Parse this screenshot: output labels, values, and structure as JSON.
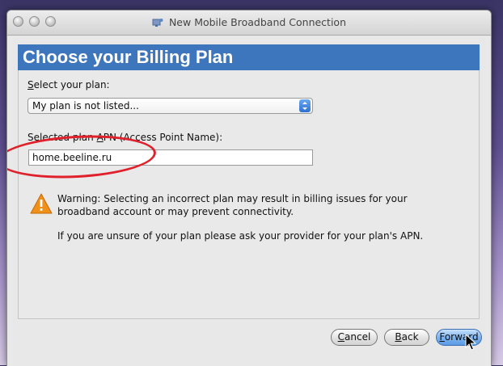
{
  "window": {
    "title": "New Mobile Broadband Connection"
  },
  "header": {
    "title": "Choose your Billing Plan"
  },
  "plan": {
    "label_prefix": "",
    "label_accel": "S",
    "label_rest": "elect your plan:",
    "selected": "My plan is not listed..."
  },
  "apn": {
    "label_pre": "Selected plan ",
    "label_accel": "A",
    "label_post": "PN (Access Point Name):",
    "value": "home.beeline.ru"
  },
  "warning": {
    "text": "Warning: Selecting an incorrect plan may result in billing issues for your broadband account or may prevent connectivity.",
    "unsure": "If you are unsure of your plan please ask your provider for your plan's APN."
  },
  "buttons": {
    "cancel_accel": "C",
    "cancel_rest": "ancel",
    "back_accel": "B",
    "back_rest": "ack",
    "forward_accel": "F",
    "forward_rest": "orward"
  },
  "colors": {
    "header_bg": "#3e76be",
    "annotation": "#e0202a",
    "warning_icon": "#f0901a"
  },
  "icons": [
    "network-icon",
    "warning-icon",
    "chevron-updown-icon",
    "mouse-cursor-icon"
  ]
}
